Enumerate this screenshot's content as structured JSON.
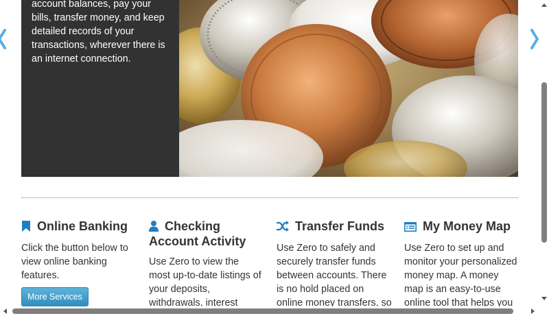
{
  "hero": {
    "caption": "account balances, pay your bills, transfer money, and keep detailed records of your transactions, wherever there is an internet connection.",
    "image_icon": "coins-image"
  },
  "carousel": {
    "prev_icon": "chevron-left-icon",
    "next_icon": "chevron-right-icon"
  },
  "features": [
    {
      "title": "Online Banking",
      "icon": "bookmark-icon",
      "text": "Click the button below to view online banking features.",
      "button_label": "More Services"
    },
    {
      "title": "Checking Account Activity",
      "icon": "user-icon",
      "text": "Use Zero to view the most up-to-date listings of your deposits, withdrawals, interest payments, and a"
    },
    {
      "title": "Transfer Funds",
      "icon": "shuffle-icon",
      "text": "Use Zero to safely and securely transfer funds between accounts. There is no hold placed on online money transfers, so your"
    },
    {
      "title": "My Money Map",
      "icon": "list-icon",
      "text": "Use Zero to set up and monitor your personalized money map. A money map is an easy-to-use online tool that helps you"
    }
  ],
  "colors": {
    "accent": "#2f8fbf",
    "icon_blue": "#1f7fc4",
    "caption_bg": "#323232",
    "divider": "#4a90c2"
  }
}
